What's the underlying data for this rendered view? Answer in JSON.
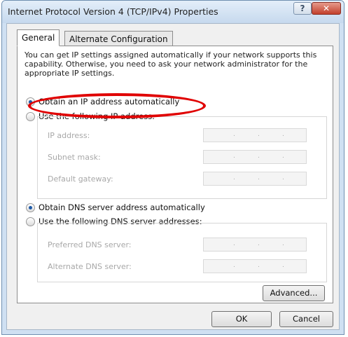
{
  "window": {
    "title": "Internet Protocol Version 4 (TCP/IPv4) Properties",
    "help_glyph": "?",
    "close_glyph": "✕"
  },
  "tabs": [
    {
      "label": "General"
    },
    {
      "label": "Alternate Configuration"
    }
  ],
  "description": "You can get IP settings assigned automatically if your network supports this capability. Otherwise, you need to ask your network administrator for the appropriate IP settings.",
  "ip": {
    "auto_label": "Obtain an IP address automatically",
    "manual_label": "Use the following IP address:",
    "fields": [
      {
        "label": "IP address:"
      },
      {
        "label": "Subnet mask:"
      },
      {
        "label": "Default gateway:"
      }
    ]
  },
  "dns": {
    "auto_label": "Obtain DNS server address automatically",
    "manual_label": "Use the following DNS server addresses:",
    "fields": [
      {
        "label": "Preferred DNS server:"
      },
      {
        "label": "Alternate DNS server:"
      }
    ]
  },
  "buttons": {
    "advanced": "Advanced...",
    "ok": "OK",
    "cancel": "Cancel"
  },
  "annotation": {
    "color": "#e00000"
  }
}
